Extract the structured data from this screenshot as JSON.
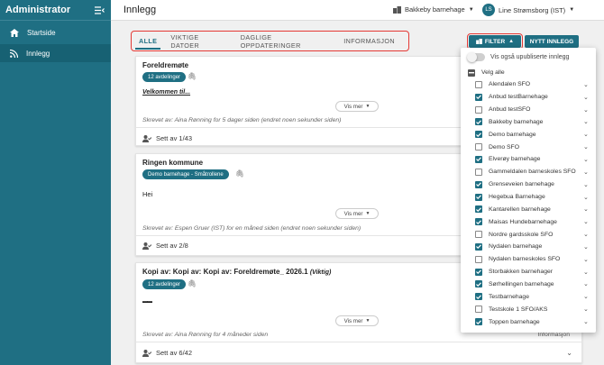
{
  "sidebar": {
    "title": "Administrator",
    "items": [
      {
        "label": "Startside",
        "icon": "home-icon"
      },
      {
        "label": "Innlegg",
        "icon": "rss-icon"
      }
    ]
  },
  "header": {
    "title": "Innlegg",
    "org": "Bakkeby barnehage",
    "user": "Line Strømsborg (IST)",
    "avatar": "LS"
  },
  "tabs": [
    "ALLE",
    "VIKTIGE DATOER",
    "DAGLIGE OPPDATERINGER",
    "INFORMASJON"
  ],
  "toolbar": {
    "filter": "FILTER",
    "new_post": "NYTT INNLEGG"
  },
  "posts": [
    {
      "title": "Foreldremøte",
      "badge": "12 avdelinger",
      "body": "Velkommen til...",
      "more": "Vis mer",
      "author": "Skrevet av: Aina Rønning for 5 dager siden (endret noen sekunder siden)",
      "seen": "Sett av 1/43"
    },
    {
      "title": "Ringen kommune",
      "badge": "Demo barnehage - Småtrollene",
      "body": "Hei",
      "more": "Vis mer",
      "author": "Skrevet av: Espen Gruer (IST) for en måned siden (endret noen sekunder siden)",
      "seen": "Sett av 2/8"
    },
    {
      "title": "Kopi av: Kopi av: Kopi av: Foreldremøte_ 2026.1",
      "tag": "(Viktig)",
      "badge": "12 avdelinger",
      "body": "▬▬",
      "more": "Vis mer",
      "author": "Skrevet av: Aina Rønning for 4 måneder siden",
      "category": "Informasjon",
      "seen": "Sett av 6/42"
    }
  ],
  "filter": {
    "toggle_label": "Vis også upubliserte innlegg",
    "select_all": "Velg alle",
    "options": [
      {
        "label": "Alendalen SFO",
        "checked": false
      },
      {
        "label": "Anbud testBarnehage",
        "checked": true
      },
      {
        "label": "Anbud testSFO",
        "checked": false
      },
      {
        "label": "Bakkeby barnehage",
        "checked": true
      },
      {
        "label": "Demo barnehage",
        "checked": true
      },
      {
        "label": "Demo SFO",
        "checked": false
      },
      {
        "label": "Elverøy barnehage",
        "checked": true
      },
      {
        "label": "Gammeldalen barneskoles SFO",
        "checked": false
      },
      {
        "label": "Grenseveien barnehage",
        "checked": true
      },
      {
        "label": "Hegebua Barnehage",
        "checked": true
      },
      {
        "label": "Kantarellen barnehage",
        "checked": true
      },
      {
        "label": "Maisas Hundebarnehage",
        "checked": true
      },
      {
        "label": "Nordre gardsskole SFO",
        "checked": false
      },
      {
        "label": "Nydalen barnehage",
        "checked": true
      },
      {
        "label": "Nydalen barneskoles SFO",
        "checked": false
      },
      {
        "label": "Storbakken barnehager",
        "checked": true
      },
      {
        "label": "Sørhellingen barnehage",
        "checked": true
      },
      {
        "label": "Testbarnehage",
        "checked": true
      },
      {
        "label": "Testskole 1 SFO/AKS",
        "checked": false
      },
      {
        "label": "Toppen barnehage",
        "checked": true
      }
    ]
  },
  "colors": {
    "primary": "#1f6f83",
    "highlight": "#e53935"
  }
}
